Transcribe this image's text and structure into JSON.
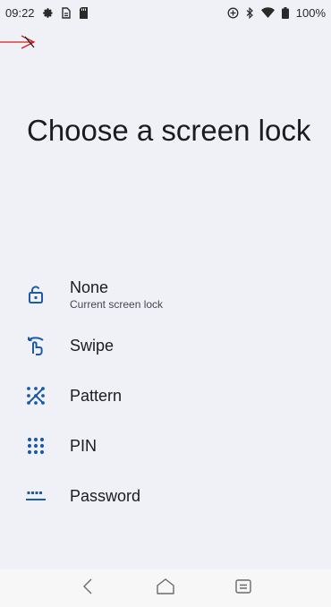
{
  "status_bar": {
    "time": "09:22",
    "battery": "100%",
    "icons": [
      "gear-icon",
      "sim-icon",
      "sd-card-icon",
      "sync-icon",
      "bluetooth-icon",
      "wifi-icon",
      "battery-icon"
    ]
  },
  "header": {
    "back_icon": "arrow-left-icon",
    "title": "Choose a screen lock"
  },
  "options": [
    {
      "label": "None",
      "sublabel": "Current screen lock",
      "icon": "unlock-icon"
    },
    {
      "label": "Swipe",
      "icon": "swipe-icon"
    },
    {
      "label": "Pattern",
      "icon": "pattern-icon"
    },
    {
      "label": "PIN",
      "icon": "pin-icon"
    },
    {
      "label": "Password",
      "icon": "password-icon"
    }
  ],
  "nav_bar": {
    "icons": [
      "back-icon",
      "home-icon",
      "recents-icon"
    ]
  },
  "colors": {
    "background": "#eff1f6",
    "accent": "#1c5aa8",
    "text": "#1b1c1f",
    "arrow": "#d22020"
  }
}
